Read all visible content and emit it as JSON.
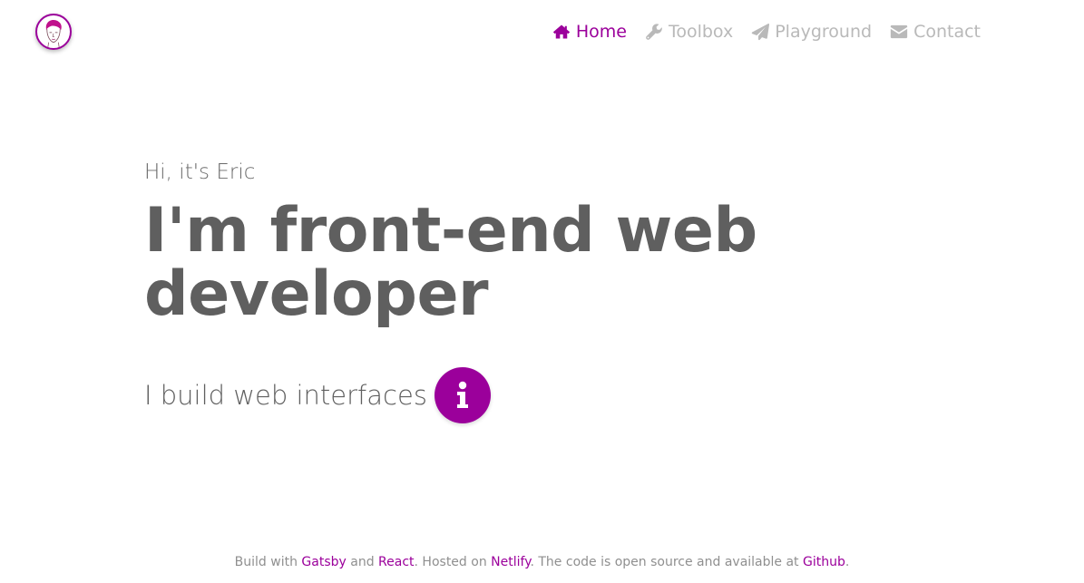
{
  "header": {
    "avatar_alt": "Eric"
  },
  "nav": {
    "items": [
      {
        "label": "Home",
        "icon": "home-icon",
        "active": true
      },
      {
        "label": "Toolbox",
        "icon": "wrench-icon",
        "active": false
      },
      {
        "label": "Playground",
        "icon": "paper-plane-icon",
        "active": false
      },
      {
        "label": "Contact",
        "icon": "envelope-icon",
        "active": false
      }
    ]
  },
  "hero": {
    "greeting": "Hi, it's Eric",
    "headline": "I'm front-end web developer",
    "tagline": "I build web interfaces"
  },
  "footer": {
    "text_1": "Build with ",
    "link_gatsby": "Gatsby",
    "text_2": " and ",
    "link_react": "React",
    "text_3": ". Hosted on ",
    "link_netlify": "Netlify",
    "text_4": ". The code is open source and available at ",
    "link_github": "Github",
    "text_5": "."
  },
  "colors": {
    "accent": "#9b009b",
    "nav_inactive": "#b9b9b9",
    "text": "#5f5f5f",
    "footer_text": "#8f8f8f",
    "background": "#ffffff"
  }
}
